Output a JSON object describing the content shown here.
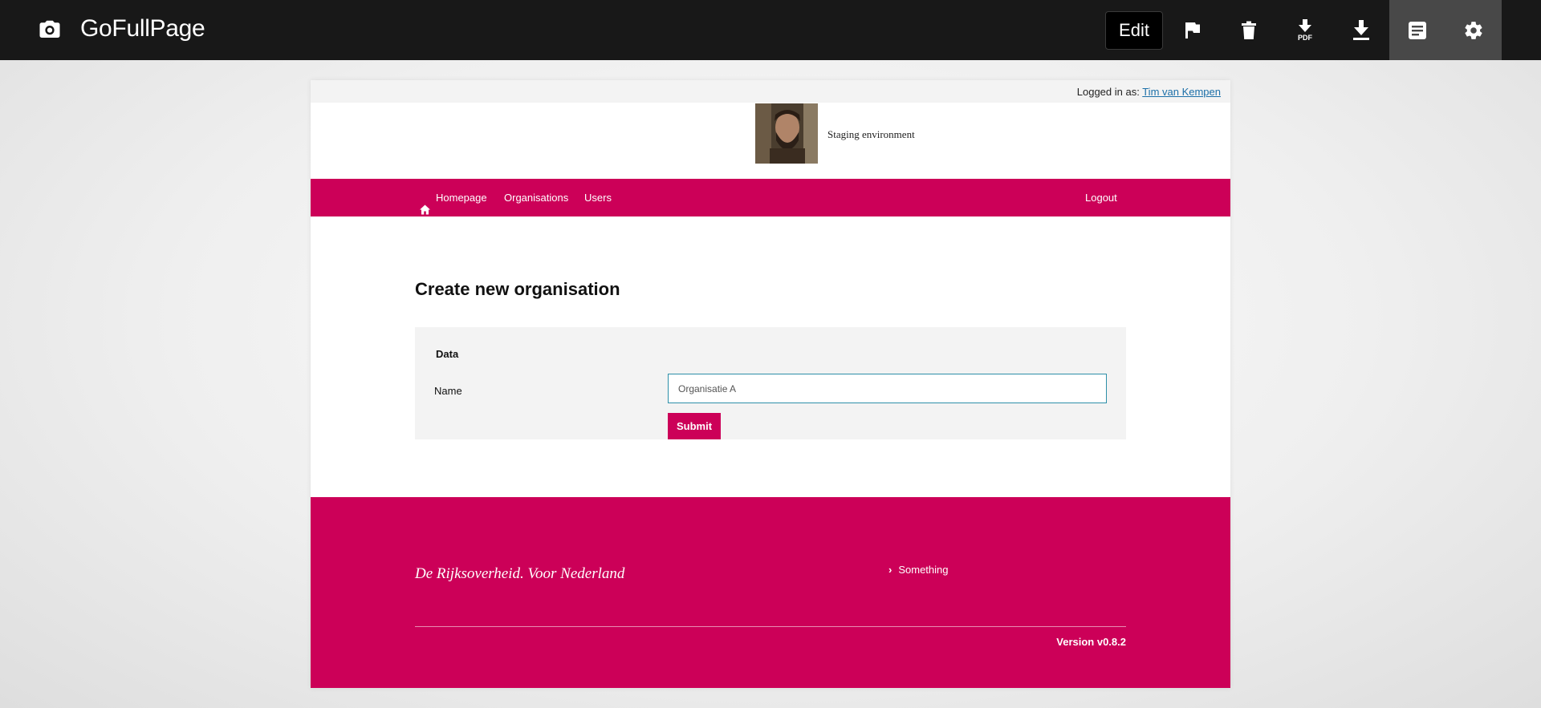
{
  "extension": {
    "name": "GoFullPage",
    "edit_label": "Edit",
    "icons": [
      "camera-icon",
      "flag-icon",
      "trash-icon",
      "download-pdf-icon",
      "download-icon",
      "notes-icon",
      "gear-icon"
    ],
    "pdf_label": "PDF"
  },
  "page": {
    "login": {
      "prefix": "Logged in as:",
      "user": "Tim van Kempen"
    },
    "environment_label": "Staging environment",
    "nav": {
      "items": [
        {
          "label": "Homepage",
          "icon": "home-icon"
        },
        {
          "label": "Organisations"
        },
        {
          "label": "Users"
        }
      ],
      "logout": "Logout"
    },
    "heading": "Create new organisation",
    "form": {
      "section_title": "Data",
      "name_label": "Name",
      "name_value": "Organisatie A",
      "submit_label": "Submit"
    },
    "footer": {
      "slogan": "De Rijksoverheid. Voor Nederland",
      "link": "Something",
      "version": "Version v0.8.2"
    }
  },
  "colors": {
    "brand": "#cc0058",
    "toolbar": "#181818",
    "link": "#1b6fa8",
    "input_border": "#2d8fa8"
  }
}
